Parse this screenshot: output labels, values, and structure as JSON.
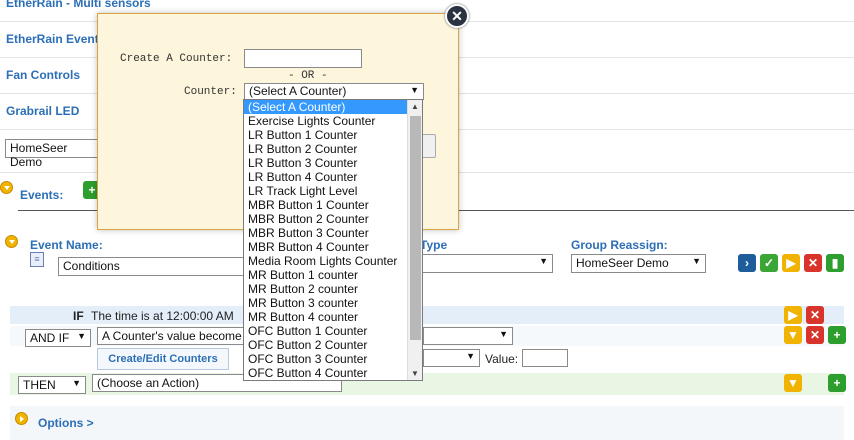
{
  "groups": {
    "g1": "EtherRain - Multi sensors",
    "g2": "EtherRain Events",
    "g3": "Fan Controls",
    "g4": "Grabrail LED"
  },
  "group_select": "HomeSeer Demo",
  "events_label": "Events:",
  "event": {
    "name_label": "Event Name:",
    "name_value": "Conditions",
    "type_label": "Type",
    "group_reassign_label": "Group Reassign:",
    "group_reassign_value": "HomeSeer Demo"
  },
  "if_row": {
    "if_label": "IF",
    "trigger_text": "The time is at 12:00:00 AM"
  },
  "and_if_row": {
    "selector": "AND IF",
    "condition": "A Counter's value become",
    "value_label": "Value:"
  },
  "create_edit_counters": "Create/Edit Counters",
  "then_row": {
    "selector": "THEN",
    "action": "(Choose an Action)"
  },
  "options_label": "Options >",
  "dialog": {
    "create_label": "Create A Counter:",
    "or_label": "- OR -",
    "counter_label": "Counter:",
    "counter_selected": "(Select A Counter)"
  },
  "counter_options": [
    "(Select A Counter)",
    "Exercise Lights Counter",
    "LR Button 1 Counter",
    "LR Button 2 Counter",
    "LR Button 3 Counter",
    "LR Button 4 Counter",
    "LR Track Light Level",
    "MBR Button 1 Counter",
    "MBR Button 2 Counter",
    "MBR Button 3 Counter",
    "MBR Button 4 Counter",
    "Media Room Lights Counter",
    "MR Button 1 counter",
    "MR Button 2 counter",
    "MR Button 3 counter",
    "MR Button 4 counter",
    "OFC Button 1 Counter",
    "OFC Button 2 Counter",
    "OFC Button 3 Counter",
    "OFC Button 4 Counter"
  ],
  "icons": {
    "close": "close-icon",
    "add": "add-icon",
    "run": "run-icon",
    "check": "check-icon",
    "play": "play-icon",
    "delete": "delete-icon",
    "group": "group-icon"
  },
  "colors": {
    "link_blue": "#2c6fb6",
    "dialog_bg": "#fdf6dc",
    "dialog_border": "#d9a441",
    "highlight": "#3399ff",
    "gold": "#f0b400",
    "red": "#d9342b",
    "green": "#2e9e2e"
  }
}
